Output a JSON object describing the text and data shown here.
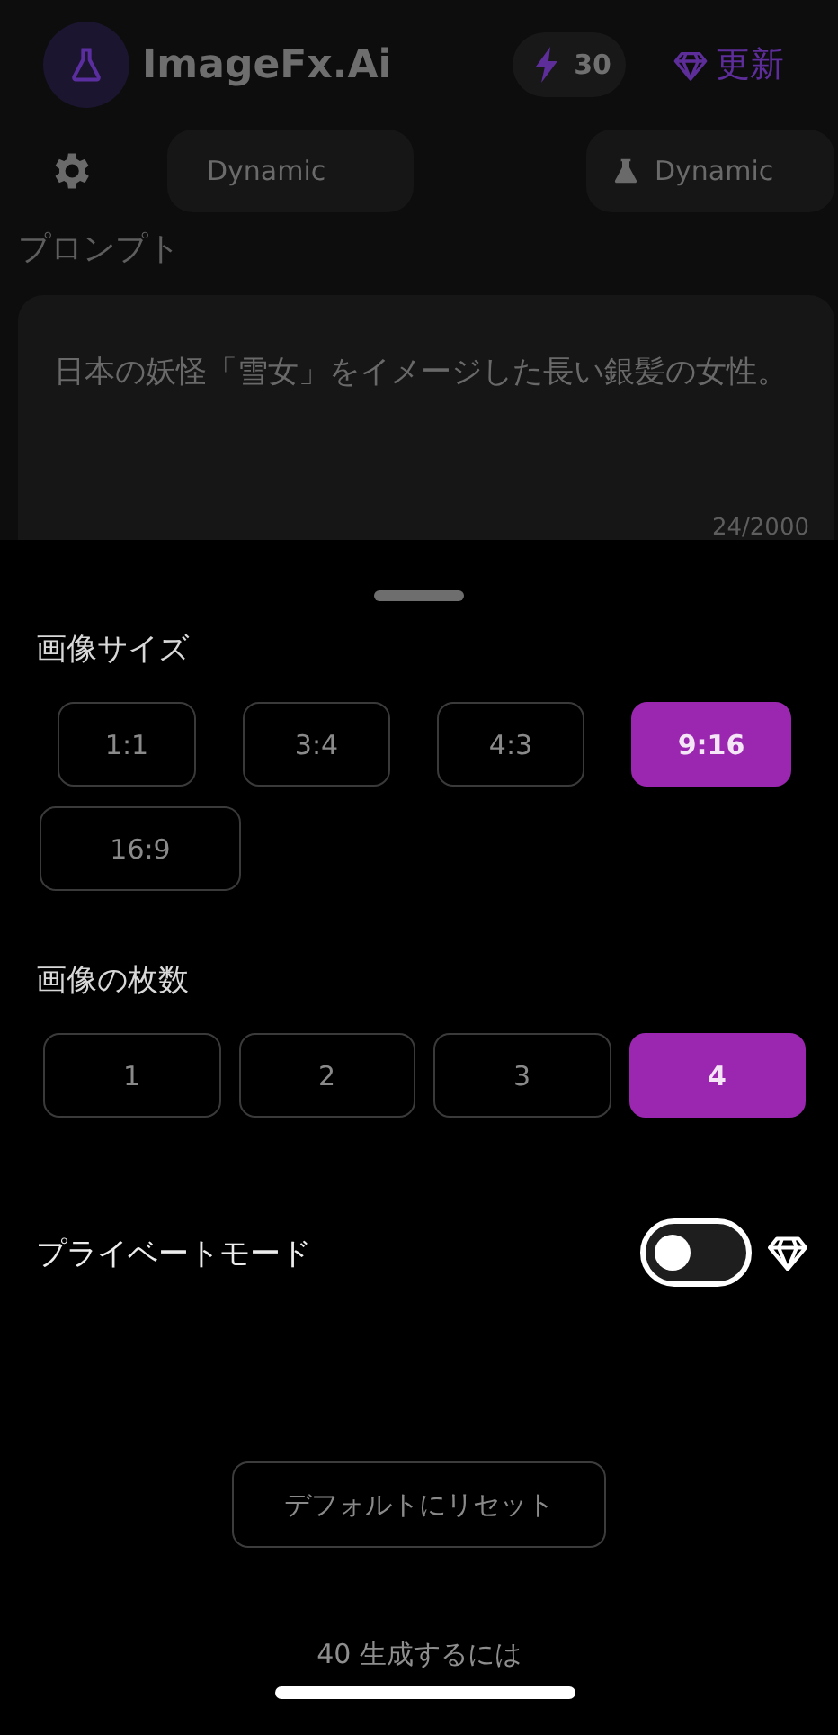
{
  "header": {
    "app_name": "ImageFx.Ai",
    "credits": "30",
    "upgrade": "更新"
  },
  "style_bar": {
    "style_left": "Dynamic",
    "style_right": "Dynamic"
  },
  "prompt": {
    "label": "プロンプト",
    "value": "日本の妖怪「雪女」をイメージした長い銀髪の女性。",
    "counter": "24/2000"
  },
  "image_size": {
    "title": "画像サイズ",
    "options": [
      {
        "label": "1:1",
        "selected": false
      },
      {
        "label": "3:4",
        "selected": false
      },
      {
        "label": "4:3",
        "selected": false
      },
      {
        "label": "9:16",
        "selected": true
      },
      {
        "label": "16:9",
        "selected": false
      }
    ]
  },
  "image_count": {
    "title": "画像の枚数",
    "options": [
      {
        "label": "1",
        "selected": false
      },
      {
        "label": "2",
        "selected": false
      },
      {
        "label": "3",
        "selected": false
      },
      {
        "label": "4",
        "selected": true
      }
    ]
  },
  "private_mode": {
    "label": "プライベートモード",
    "on": false
  },
  "reset_button": "デフォルトにリセット",
  "footer_note": "40 生成するには"
}
